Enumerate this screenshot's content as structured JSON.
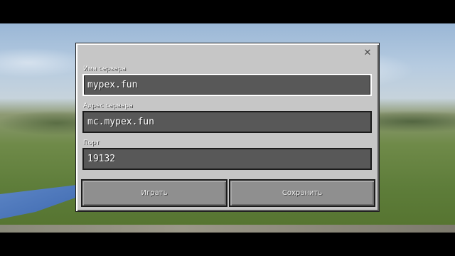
{
  "form": {
    "server_name_label": "Имя сервера",
    "server_name_value": "mypex.fun",
    "server_address_label": "Адрес сервера",
    "server_address_value": "mc.mypex.fun",
    "port_label": "Порт",
    "port_value": "19132"
  },
  "buttons": {
    "play_label": "Играть",
    "save_label": "Сохранить"
  },
  "icons": {
    "close": "close-icon"
  }
}
